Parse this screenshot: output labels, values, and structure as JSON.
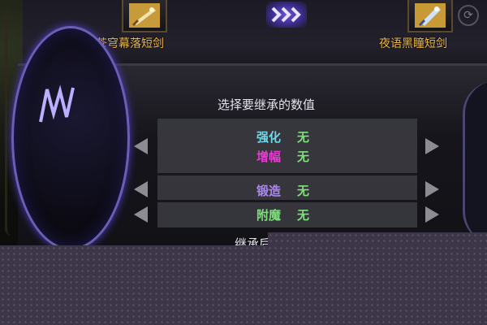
{
  "items": {
    "source_name": "苍穹幕落短剑",
    "target_name": "夜语黑瞳短剑"
  },
  "inherit": {
    "title": "选择要继承的数值",
    "rows": [
      {
        "label": "强化",
        "value": "无",
        "label_color": "#6fd8e8"
      },
      {
        "label": "增幅",
        "value": "无",
        "label_color": "#e23fcf"
      },
      {
        "label": "锻造",
        "value": "无",
        "label_color": "#a98ae8"
      },
      {
        "label": "附魔",
        "value": "无",
        "label_color": "#7de07a"
      }
    ],
    "footer_partial": "继承后"
  },
  "colors": {
    "item_name": "#e9b64a",
    "value": "#7de07a",
    "arrow_badge": "#6a4fd6"
  },
  "icons": [
    "sword-item-icon",
    "triple-chevron-icon",
    "refresh-icon",
    "left-arrow-icon",
    "right-arrow-icon",
    "rune-glyph-icon"
  ]
}
